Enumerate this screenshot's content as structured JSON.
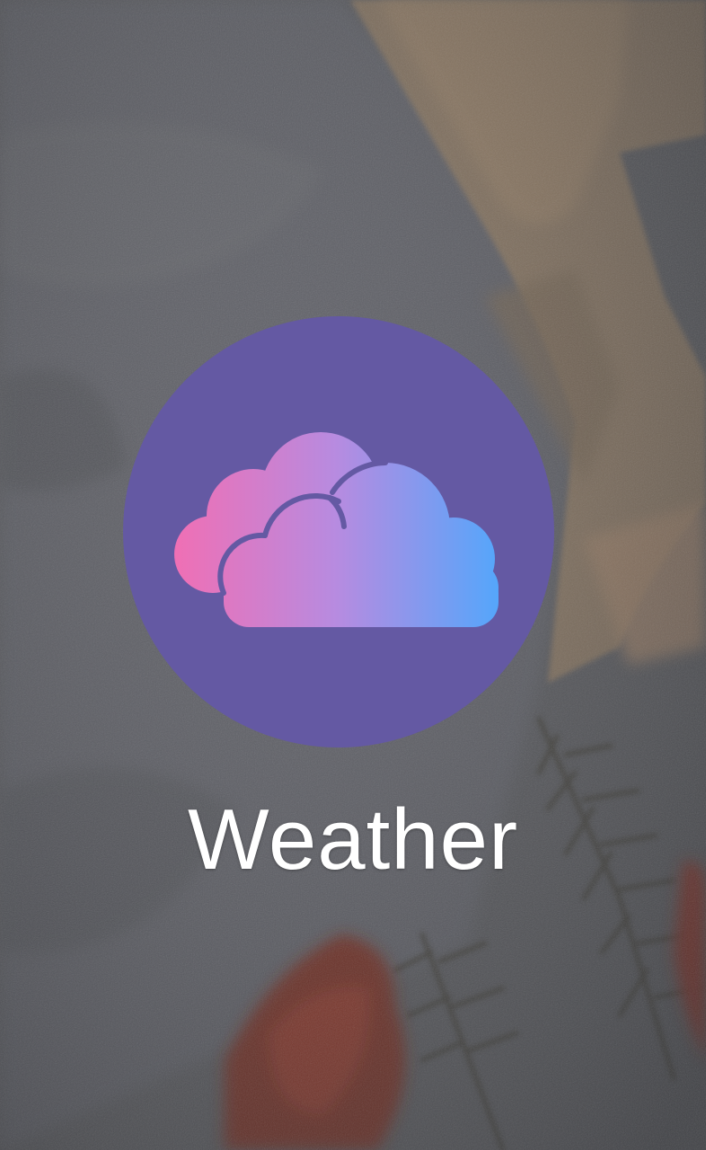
{
  "home_screen": {
    "app": {
      "label": "Weather",
      "icon": "cloud-icon",
      "badge_color": "#6459a3",
      "gradient_colors": [
        "#f06fb4",
        "#b78be0",
        "#55a6fb"
      ]
    }
  }
}
